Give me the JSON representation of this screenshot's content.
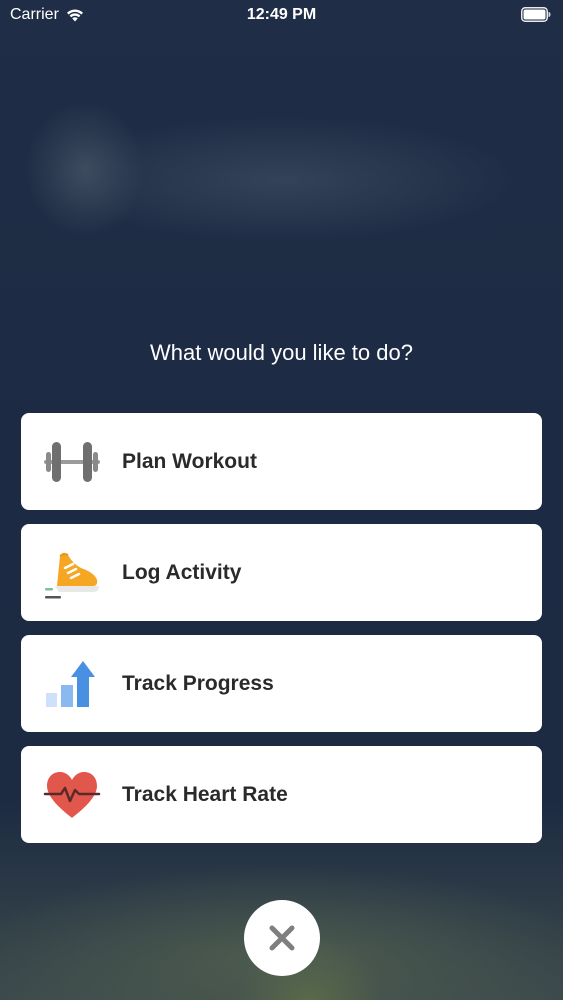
{
  "status_bar": {
    "carrier": "Carrier",
    "time": "12:49 PM",
    "wifi_icon": "wifi-icon",
    "battery_icon": "battery-full-icon"
  },
  "prompt": "What would you like to do?",
  "menu": [
    {
      "label": "Plan Workout",
      "icon": "dumbbell-icon",
      "icon_color": "#7a7a7a"
    },
    {
      "label": "Log Activity",
      "icon": "running-shoe-icon",
      "icon_color": "#f5a623"
    },
    {
      "label": "Track Progress",
      "icon": "progress-chart-icon",
      "icon_color": "#4a90e2"
    },
    {
      "label": "Track Heart Rate",
      "icon": "heart-rate-icon",
      "icon_color": "#e2574c"
    }
  ],
  "close_icon": "close-icon",
  "colors": {
    "background": "#1d2c45",
    "card": "#ffffff",
    "label_text": "#2a2a2a",
    "close_icon": "#7f7f7f"
  }
}
